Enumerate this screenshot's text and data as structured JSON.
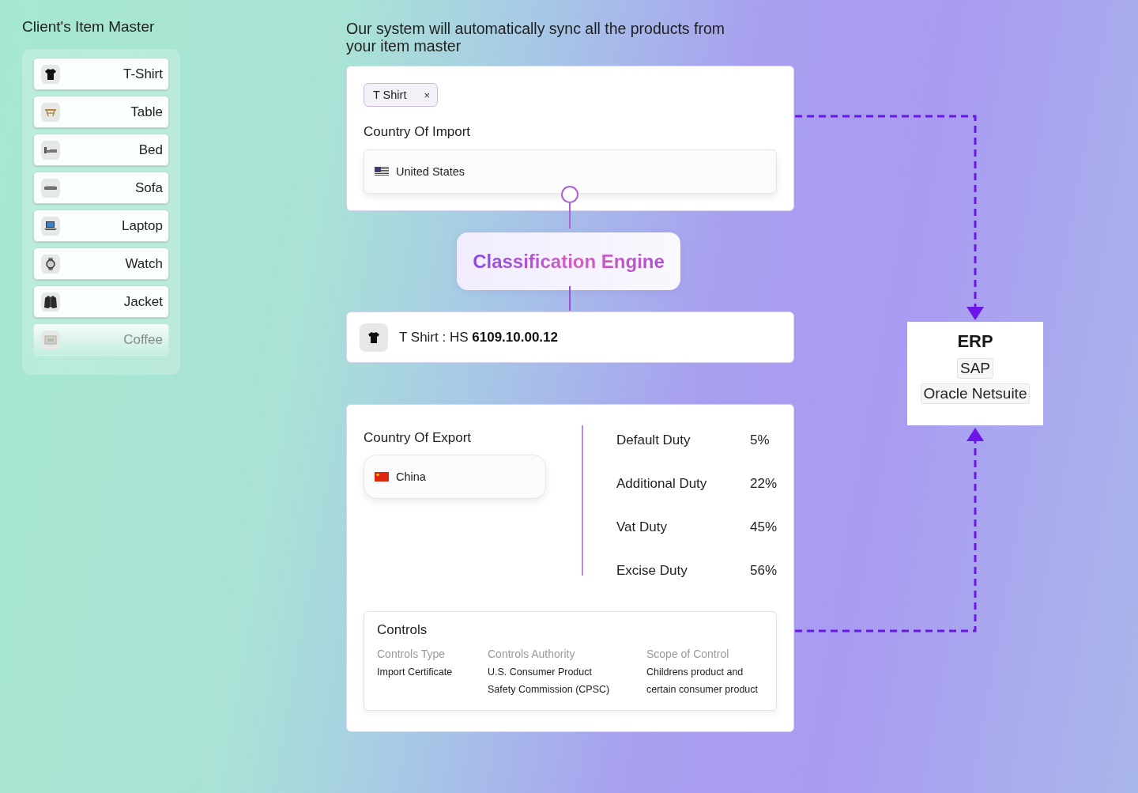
{
  "left_panel": {
    "title": "Client's Item Master",
    "items": [
      {
        "label": "T-Shirt",
        "kind": "tshirt",
        "faded": false
      },
      {
        "label": "Table",
        "kind": "table",
        "faded": false
      },
      {
        "label": "Bed",
        "kind": "bed",
        "faded": false
      },
      {
        "label": "Sofa",
        "kind": "sofa",
        "faded": false
      },
      {
        "label": "Laptop",
        "kind": "laptop",
        "faded": false
      },
      {
        "label": "Watch",
        "kind": "watch",
        "faded": false
      },
      {
        "label": "Jacket",
        "kind": "jacket",
        "faded": false
      },
      {
        "label": "Coffee",
        "kind": "coffee",
        "faded": true
      }
    ]
  },
  "headline": "Our system will automatically sync all the products from your item master",
  "import_card": {
    "tag": {
      "label": "T Shirt",
      "remove": "×"
    },
    "country_label": "Country Of Import",
    "country": {
      "name": "United States",
      "kind": "us"
    }
  },
  "engine": {
    "label": "Classification Engine"
  },
  "result": {
    "text": "T Shirt : HS **6109.10.00.12**"
  },
  "export_card": {
    "country_label": "Country Of Export",
    "country": {
      "name": "China",
      "kind": "cn"
    },
    "duties": [
      {
        "label": "Default Duty",
        "value": "5%"
      },
      {
        "label": "Additional Duty",
        "value": "22%"
      },
      {
        "label": "Vat Duty",
        "value": "45%"
      },
      {
        "label": "Excise Duty",
        "value": "56%"
      }
    ],
    "controls": {
      "title": "Controls",
      "columns": [
        {
          "heading": "Controls Type",
          "value": "Import Certificate"
        },
        {
          "heading": "Controls Authority",
          "value": "U.S. Consumer Product Safety Commission (CPSC)"
        },
        {
          "heading": "Scope of Control",
          "value": "Childrens product and certain consumer product"
        }
      ]
    }
  },
  "erp": {
    "title": "ERP",
    "systems": [
      "SAP",
      "Oracle Netsuite"
    ]
  }
}
